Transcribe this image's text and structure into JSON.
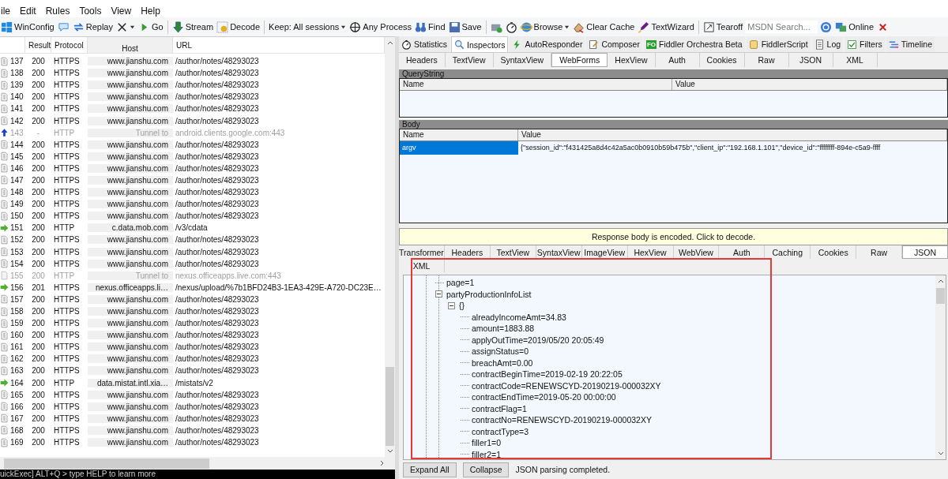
{
  "menu": [
    "ile",
    "Edit",
    "Rules",
    "Tools",
    "View",
    "Help"
  ],
  "toolbar": [
    {
      "kind": "button",
      "label": "WinConfig"
    },
    {
      "kind": "icon"
    },
    {
      "kind": "button",
      "label": "Replay"
    },
    {
      "kind": "icon-menu"
    },
    {
      "kind": "button",
      "label": "Go"
    },
    {
      "kind": "separator"
    },
    {
      "kind": "button",
      "label": "Stream"
    },
    {
      "kind": "button",
      "label": "Decode"
    },
    {
      "kind": "separator"
    },
    {
      "kind": "dropdown",
      "label": "Keep: All sessions"
    },
    {
      "kind": "button",
      "label": "Any Process"
    },
    {
      "kind": "button",
      "label": "Find"
    },
    {
      "kind": "button",
      "label": "Save"
    },
    {
      "kind": "separator"
    },
    {
      "kind": "icon"
    },
    {
      "kind": "icon"
    },
    {
      "kind": "menu",
      "label": "Browse"
    },
    {
      "kind": "button",
      "label": "Clear Cache"
    },
    {
      "kind": "button",
      "label": "TextWizard"
    },
    {
      "kind": "separator"
    },
    {
      "kind": "button",
      "label": "Tearoff"
    },
    {
      "kind": "search",
      "placeholder": "MSDN Search..."
    },
    {
      "kind": "icon"
    },
    {
      "kind": "button",
      "label": "Online"
    },
    {
      "kind": "icon"
    }
  ],
  "sessions": {
    "columns": [
      "Result",
      "Protocol",
      "Host",
      "URL"
    ],
    "rows": [
      {
        "id": "137",
        "result": "200",
        "protocol": "HTTPS",
        "host": "www.jianshu.com",
        "url": "/author/notes/48293023",
        "kind": "https",
        "dimmed": false
      },
      {
        "id": "138",
        "result": "200",
        "protocol": "HTTPS",
        "host": "www.jianshu.com",
        "url": "/author/notes/48293023",
        "kind": "https",
        "dimmed": false
      },
      {
        "id": "139",
        "result": "200",
        "protocol": "HTTPS",
        "host": "www.jianshu.com",
        "url": "/author/notes/48293023",
        "kind": "https",
        "dimmed": false
      },
      {
        "id": "140",
        "result": "200",
        "protocol": "HTTPS",
        "host": "www.jianshu.com",
        "url": "/author/notes/48293023",
        "kind": "https",
        "dimmed": false
      },
      {
        "id": "141",
        "result": "200",
        "protocol": "HTTPS",
        "host": "www.jianshu.com",
        "url": "/author/notes/48293023",
        "kind": "https",
        "dimmed": false
      },
      {
        "id": "142",
        "result": "200",
        "protocol": "HTTPS",
        "host": "www.jianshu.com",
        "url": "/author/notes/48293023",
        "kind": "https",
        "dimmed": false
      },
      {
        "id": "143",
        "result": "-",
        "protocol": "HTTP",
        "host": "Tunnel to",
        "url": "android.clients.google.com:443",
        "kind": "tunnel",
        "dimmed": true
      },
      {
        "id": "144",
        "result": "200",
        "protocol": "HTTPS",
        "host": "www.jianshu.com",
        "url": "/author/notes/48293023",
        "kind": "https",
        "dimmed": false
      },
      {
        "id": "145",
        "result": "200",
        "protocol": "HTTPS",
        "host": "www.jianshu.com",
        "url": "/author/notes/48293023",
        "kind": "https",
        "dimmed": false
      },
      {
        "id": "146",
        "result": "200",
        "protocol": "HTTPS",
        "host": "www.jianshu.com",
        "url": "/author/notes/48293023",
        "kind": "https",
        "dimmed": false
      },
      {
        "id": "147",
        "result": "200",
        "protocol": "HTTPS",
        "host": "www.jianshu.com",
        "url": "/author/notes/48293023",
        "kind": "https",
        "dimmed": false
      },
      {
        "id": "148",
        "result": "200",
        "protocol": "HTTPS",
        "host": "www.jianshu.com",
        "url": "/author/notes/48293023",
        "kind": "https",
        "dimmed": false
      },
      {
        "id": "149",
        "result": "200",
        "protocol": "HTTPS",
        "host": "www.jianshu.com",
        "url": "/author/notes/48293023",
        "kind": "https",
        "dimmed": false
      },
      {
        "id": "150",
        "result": "200",
        "protocol": "HTTPS",
        "host": "www.jianshu.com",
        "url": "/author/notes/48293023",
        "kind": "https",
        "dimmed": false
      },
      {
        "id": "151",
        "result": "200",
        "protocol": "HTTP",
        "host": "c.data.mob.com",
        "url": "/v3/cdata",
        "kind": "upload",
        "dimmed": false
      },
      {
        "id": "152",
        "result": "200",
        "protocol": "HTTPS",
        "host": "www.jianshu.com",
        "url": "/author/notes/48293023",
        "kind": "https",
        "dimmed": false
      },
      {
        "id": "153",
        "result": "200",
        "protocol": "HTTPS",
        "host": "www.jianshu.com",
        "url": "/author/notes/48293023",
        "kind": "https",
        "dimmed": false
      },
      {
        "id": "154",
        "result": "200",
        "protocol": "HTTPS",
        "host": "www.jianshu.com",
        "url": "/author/notes/48293023",
        "kind": "https",
        "dimmed": false
      },
      {
        "id": "155",
        "result": "200",
        "protocol": "HTTP",
        "host": "Tunnel to",
        "url": "nexus.officeapps.live.com:443",
        "kind": "blank",
        "dimmed": true
      },
      {
        "id": "156",
        "result": "201",
        "protocol": "HTTPS",
        "host": "nexus.officeapps.li…",
        "url": "/nexus/upload/%7b1BFD24B3-1EA3-429E-A720-DC23E…",
        "kind": "upload",
        "dimmed": false
      },
      {
        "id": "157",
        "result": "200",
        "protocol": "HTTPS",
        "host": "www.jianshu.com",
        "url": "/author/notes/48293023",
        "kind": "https",
        "dimmed": false
      },
      {
        "id": "158",
        "result": "200",
        "protocol": "HTTPS",
        "host": "www.jianshu.com",
        "url": "/author/notes/48293023",
        "kind": "https",
        "dimmed": false
      },
      {
        "id": "159",
        "result": "200",
        "protocol": "HTTPS",
        "host": "www.jianshu.com",
        "url": "/author/notes/48293023",
        "kind": "https",
        "dimmed": false
      },
      {
        "id": "160",
        "result": "200",
        "protocol": "HTTPS",
        "host": "www.jianshu.com",
        "url": "/author/notes/48293023",
        "kind": "https",
        "dimmed": false
      },
      {
        "id": "161",
        "result": "200",
        "protocol": "HTTPS",
        "host": "www.jianshu.com",
        "url": "/author/notes/48293023",
        "kind": "https",
        "dimmed": false
      },
      {
        "id": "162",
        "result": "200",
        "protocol": "HTTPS",
        "host": "www.jianshu.com",
        "url": "/author/notes/48293023",
        "kind": "https",
        "dimmed": false
      },
      {
        "id": "163",
        "result": "200",
        "protocol": "HTTPS",
        "host": "www.jianshu.com",
        "url": "/author/notes/48293023",
        "kind": "https",
        "dimmed": false
      },
      {
        "id": "164",
        "result": "200",
        "protocol": "HTTP",
        "host": "data.mistat.intl.xia…",
        "url": "/mistats/v2",
        "kind": "upload",
        "dimmed": false
      },
      {
        "id": "165",
        "result": "200",
        "protocol": "HTTPS",
        "host": "www.jianshu.com",
        "url": "/author/notes/48293023",
        "kind": "https",
        "dimmed": false
      },
      {
        "id": "166",
        "result": "200",
        "protocol": "HTTPS",
        "host": "www.jianshu.com",
        "url": "/author/notes/48293023",
        "kind": "https",
        "dimmed": false
      },
      {
        "id": "167",
        "result": "200",
        "protocol": "HTTPS",
        "host": "www.jianshu.com",
        "url": "/author/notes/48293023",
        "kind": "https",
        "dimmed": false
      },
      {
        "id": "168",
        "result": "200",
        "protocol": "HTTPS",
        "host": "www.jianshu.com",
        "url": "/author/notes/48293023",
        "kind": "https",
        "dimmed": false
      },
      {
        "id": "169",
        "result": "200",
        "protocol": "HTTPS",
        "host": "www.jianshu.com",
        "url": "/author/notes/48293023",
        "kind": "https",
        "dimmed": false
      }
    ]
  },
  "quickexec": "uickExec] ALT+Q > type HELP to learn more",
  "inspector": {
    "tabs": [
      {
        "label": "Statistics",
        "selected": false
      },
      {
        "label": "Inspectors",
        "selected": true
      },
      {
        "label": "AutoResponder",
        "selected": false
      },
      {
        "label": "Composer",
        "selected": false
      },
      {
        "label": "Fiddler Orchestra Beta",
        "badge": "FO",
        "selected": false
      },
      {
        "label": "FiddlerScript",
        "selected": false
      },
      {
        "label": "Log",
        "selected": false
      },
      {
        "label": "Filters",
        "selected": false
      },
      {
        "label": "Timeline",
        "selected": false
      }
    ],
    "request_tabs": [
      {
        "label": "Headers",
        "selected": false
      },
      {
        "label": "TextView",
        "selected": false
      },
      {
        "label": "SyntaxView",
        "selected": false
      },
      {
        "label": "WebForms",
        "selected": true
      },
      {
        "label": "HexView",
        "selected": false
      },
      {
        "label": "Auth",
        "selected": false
      },
      {
        "label": "Cookies",
        "selected": false
      },
      {
        "label": "Raw",
        "selected": false
      },
      {
        "label": "JSON",
        "selected": false
      },
      {
        "label": "XML",
        "selected": false
      }
    ],
    "querystring": {
      "title": "QueryString",
      "columns": [
        "Name",
        "Value"
      ]
    },
    "body": {
      "title": "Body",
      "columns": [
        "Name",
        "Value"
      ],
      "rows": [
        {
          "name": "argv",
          "value": "{\"session_id\":\"f431425a8d4c42a5ac0b0910b59b475b\",\"client_ip\":\"192.168.1.101\",\"device_id\":\"ffffffff-894e-c5a9-ffff",
          "selected": true
        }
      ]
    },
    "notice": "Response body is encoded. Click to decode.",
    "response_tabs": [
      {
        "label": "Transformer",
        "selected": false
      },
      {
        "label": "Headers",
        "selected": false
      },
      {
        "label": "TextView",
        "selected": false
      },
      {
        "label": "SyntaxView",
        "selected": false
      },
      {
        "label": "ImageView",
        "selected": false
      },
      {
        "label": "HexView",
        "selected": false
      },
      {
        "label": "WebView",
        "selected": false
      },
      {
        "label": "Auth",
        "selected": false
      },
      {
        "label": "Caching",
        "selected": false
      },
      {
        "label": "Cookies",
        "selected": false
      },
      {
        "label": "Raw",
        "selected": false
      },
      {
        "label": "JSON",
        "selected": true
      },
      {
        "label": "XML",
        "selected": false
      }
    ],
    "tree": [
      {
        "label": "page=1"
      },
      {
        "label": "partyProductionInfoList",
        "expanded": true,
        "children": [
          {
            "label": "{}",
            "expanded": true,
            "children": [
              {
                "label": "alreadyIncomeAmt=34.83"
              },
              {
                "label": "amount=1883.88"
              },
              {
                "label": "applyOutTime=2019/05/20 20:05:49"
              },
              {
                "label": "assignStatus=0"
              },
              {
                "label": "breachAmt=0.00"
              },
              {
                "label": "contractBeginTime=2019-02-19 20:22:05"
              },
              {
                "label": "contractCode=RENEWSCYD-20190219-000032XY"
              },
              {
                "label": "contractEndTime=2019-05-20 00:00:00"
              },
              {
                "label": "contractFlag=1"
              },
              {
                "label": "contractNo=RENEWSCYD-20190219-000032XY"
              },
              {
                "label": "contractType=3"
              },
              {
                "label": "filler1=0"
              },
              {
                "label": "filler2=1"
              }
            ]
          }
        ]
      }
    ],
    "buttons": [
      "Expand All",
      "Collapse"
    ],
    "status": "JSON parsing completed."
  },
  "annotations": [
    {
      "kind": "rectangle"
    }
  ]
}
